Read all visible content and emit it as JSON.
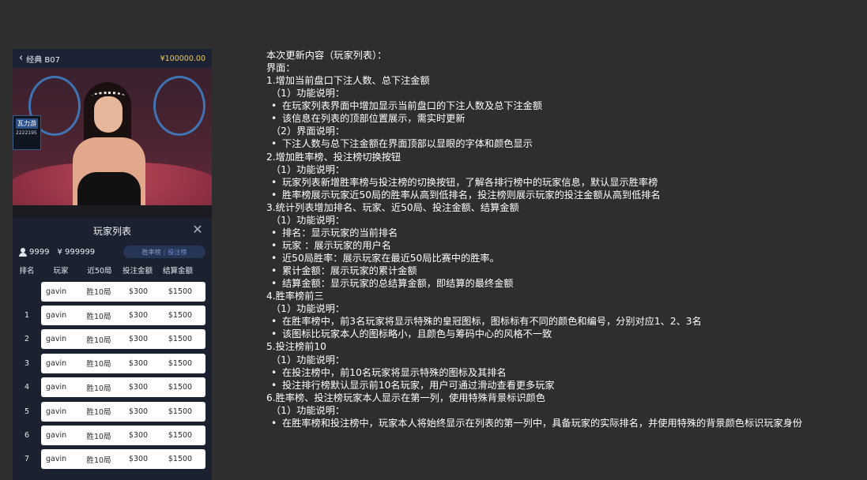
{
  "phone": {
    "back_label": "经典 B07",
    "balance": "¥100000.00",
    "side_card_title": "瓦力游",
    "side_card_sub": "2222195",
    "panel_title": "玩家列表",
    "player_count": "9999",
    "total_bet": "¥ 999999",
    "toggle_win": "胜率榜",
    "toggle_sep": "|",
    "toggle_bet": "投注榜",
    "columns": [
      "排名",
      "玩家",
      "近50局",
      "投注金额",
      "结算金额"
    ],
    "rows": [
      {
        "rank": "",
        "player": "gavin",
        "recent": "胜10局",
        "bet": "$300",
        "settle": "$1500"
      },
      {
        "rank": "1",
        "player": "gavin",
        "recent": "胜10局",
        "bet": "$300",
        "settle": "$1500"
      },
      {
        "rank": "2",
        "player": "gavin",
        "recent": "胜10局",
        "bet": "$300",
        "settle": "$1500"
      },
      {
        "rank": "3",
        "player": "gavin",
        "recent": "胜10局",
        "bet": "$300",
        "settle": "$1500"
      },
      {
        "rank": "4",
        "player": "gavin",
        "recent": "胜10局",
        "bet": "$300",
        "settle": "$1500"
      },
      {
        "rank": "5",
        "player": "gavin",
        "recent": "胜10局",
        "bet": "$300",
        "settle": "$1500"
      },
      {
        "rank": "6",
        "player": "gavin",
        "recent": "胜10局",
        "bet": "$300",
        "settle": "$1500"
      },
      {
        "rank": "7",
        "player": "gavin",
        "recent": "胜10局",
        "bet": "$300",
        "settle": "$1500"
      }
    ]
  },
  "notes": [
    {
      "style": "plain",
      "text": "本次更新内容（玩家列表）："
    },
    {
      "style": "plain",
      "text": "界面："
    },
    {
      "style": "plain",
      "text": "1.增加当前盘口下注人数、总下注金额"
    },
    {
      "style": "ind",
      "text": "（1）功能说明："
    },
    {
      "style": "bullet",
      "text": "在玩家列表界面中增加显示当前盘口的下注人数及总下注金额"
    },
    {
      "style": "bullet",
      "text": "该信息在列表的顶部位置展示，需实时更新"
    },
    {
      "style": "ind",
      "text": "（2）界面说明："
    },
    {
      "style": "bullet",
      "text": "下注人数与总下注金额在界面顶部以显眼的字体和颜色显示"
    },
    {
      "style": "plain",
      "text": "2.增加胜率榜、投注榜切换按钮"
    },
    {
      "style": "ind",
      "text": "（1）功能说明："
    },
    {
      "style": "bullet",
      "text": "玩家列表新增胜率榜与投注榜的切换按钮，了解各排行榜中的玩家信息，默认显示胜率榜"
    },
    {
      "style": "bullet",
      "text": "胜率榜展示玩家近50局的胜率从高到低排名，投注榜则展示玩家的投注金额从高到低排名"
    },
    {
      "style": "plain",
      "text": "3.统计列表增加排名、玩家、近50局、投注金额、结算金额"
    },
    {
      "style": "ind",
      "text": "（1）功能说明："
    },
    {
      "style": "bullet",
      "text": "排名：显示玩家的当前排名"
    },
    {
      "style": "bullet",
      "text": "玩家 ：展示玩家的用户名"
    },
    {
      "style": "bullet",
      "text": "近50局胜率：展示玩家在最近50局比赛中的胜率。"
    },
    {
      "style": "bullet",
      "text": "累计金额：展示玩家的累计金额"
    },
    {
      "style": "bullet",
      "text": "结算金额：显示玩家的总结算金额，即结算的最终金额"
    },
    {
      "style": "plain",
      "text": "4.胜率榜前三"
    },
    {
      "style": "ind",
      "text": "（1）功能说明："
    },
    {
      "style": "bullet",
      "text": "在胜率榜中，前3名玩家将显示特殊的皇冠图标，图标标有不同的颜色和编号，分别对应1、2、3名"
    },
    {
      "style": "bullet",
      "text": "该图标比玩家本人的图标略小，且颜色与筹码中心的风格不一致"
    },
    {
      "style": "plain",
      "text": "5.投注榜前10"
    },
    {
      "style": "ind",
      "text": "（1）功能说明："
    },
    {
      "style": "bullet",
      "text": "在投注榜中，前10名玩家将显示特殊的图标及其排名"
    },
    {
      "style": "bullet",
      "text": "投注排行榜默认显示前10名玩家，用户可通过滑动查看更多玩家"
    },
    {
      "style": "plain",
      "text": "6.胜率榜、投注榜玩家本人显示在第一列，使用特殊背景标识颜色"
    },
    {
      "style": "ind",
      "text": "（1）功能说明："
    },
    {
      "style": "bullet",
      "text": "在胜率榜和投注榜中，玩家本人将始终显示在列表的第一列中，具备玩家的实际排名，并使用特殊的背景颜色标识玩家身份"
    }
  ]
}
